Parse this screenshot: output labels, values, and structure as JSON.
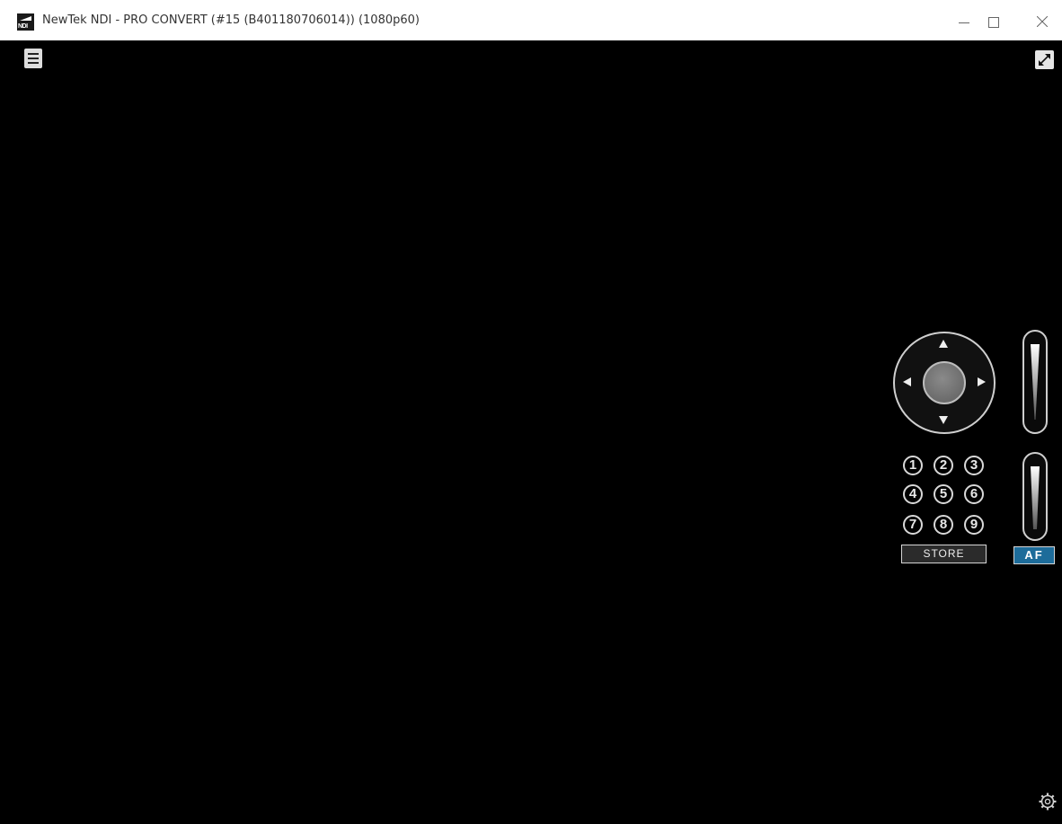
{
  "window": {
    "title": "NewTek NDI - PRO CONVERT (#15 (B401180706014)) (1080p60)",
    "app_icon_text": "NDI",
    "controls": [
      "minimize",
      "maximize",
      "close"
    ]
  },
  "overlay": {
    "menu_icon": "hamburger-icon",
    "fullscreen_icon": "expand-icon",
    "settings_icon": "gear-icon"
  },
  "ptz": {
    "joystick": {
      "arrows": [
        "up",
        "down",
        "left",
        "right"
      ]
    },
    "presets": [
      "1",
      "2",
      "3",
      "4",
      "5",
      "6",
      "7",
      "8",
      "9"
    ],
    "store_label": "STORE",
    "af_label": "AF"
  },
  "colors": {
    "background": "#000000",
    "af_accent": "#1d6c9a",
    "titlebar": "#ffffff"
  }
}
